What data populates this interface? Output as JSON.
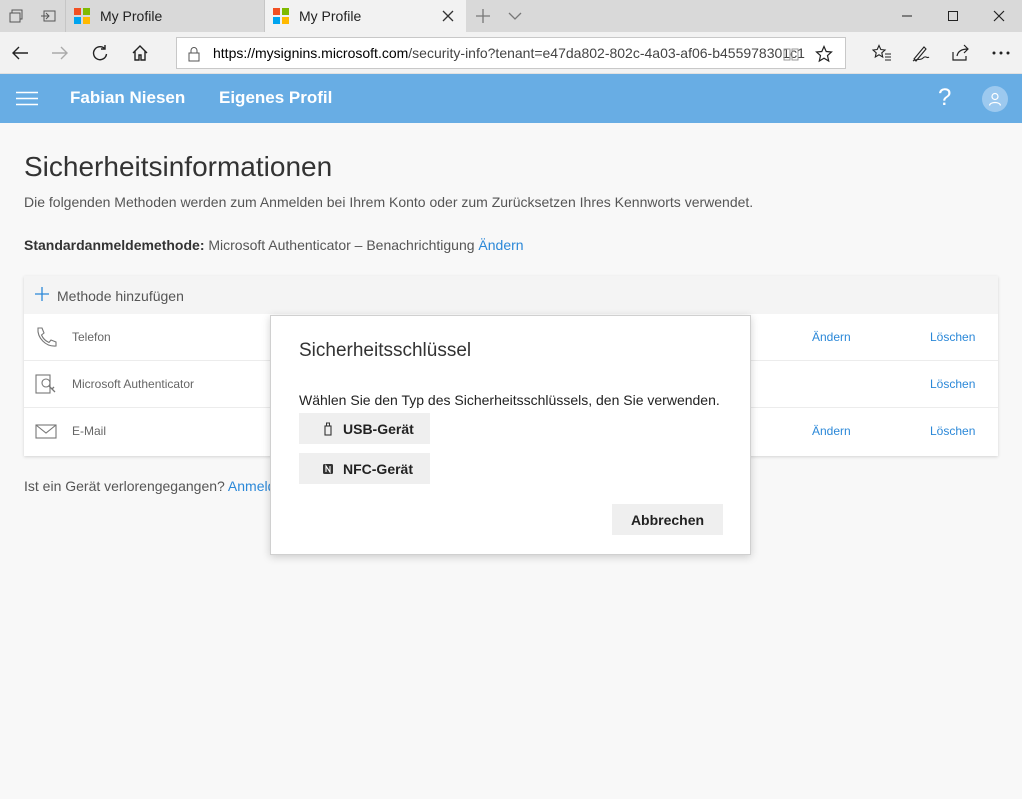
{
  "browser": {
    "tabs": [
      {
        "title": "My Profile",
        "active": false
      },
      {
        "title": "My Profile",
        "active": true
      }
    ],
    "url_host": "https://mysignins.microsoft.com",
    "url_path": "/security-info?tenant=e47da802-802c-4a03-af06-b455978301c1"
  },
  "header": {
    "user_name": "Fabian Niesen",
    "profile_link": "Eigenes Profil",
    "help_glyph": "?"
  },
  "page": {
    "title": "Sicherheitsinformationen",
    "subtitle": "Die folgenden Methoden werden zum Anmelden bei Ihrem Konto oder zum Zurücksetzen Ihres Kennworts verwendet.",
    "default_method_label": "Standardanmeldemethode:",
    "default_method_value": " Microsoft Authenticator – Benachrichtigung ",
    "default_method_change": "Ändern",
    "add_method": "Methode hinzufügen",
    "methods": [
      {
        "name": "Telefon",
        "icon": "phone-icon",
        "change": "Ändern",
        "delete": "Löschen"
      },
      {
        "name": "Microsoft Authenticator",
        "icon": "authenticator-icon",
        "change": "",
        "delete": "Löschen"
      },
      {
        "name": "E-Mail",
        "icon": "mail-icon",
        "change": "Ändern",
        "delete": "Löschen"
      }
    ],
    "lost_device_text": "Ist ein Gerät verlorengegangen? ",
    "lost_device_link": "Anmeld"
  },
  "dialog": {
    "title": "Sicherheitsschlüssel",
    "text": "Wählen Sie den Typ des Sicherheitsschlüssels, den Sie verwenden.",
    "usb_label": "USB-Gerät",
    "nfc_label": "NFC-Gerät",
    "cancel_label": "Abbrechen"
  },
  "colors": {
    "header_blue": "#68ade4",
    "link_blue": "#2b88d8"
  }
}
